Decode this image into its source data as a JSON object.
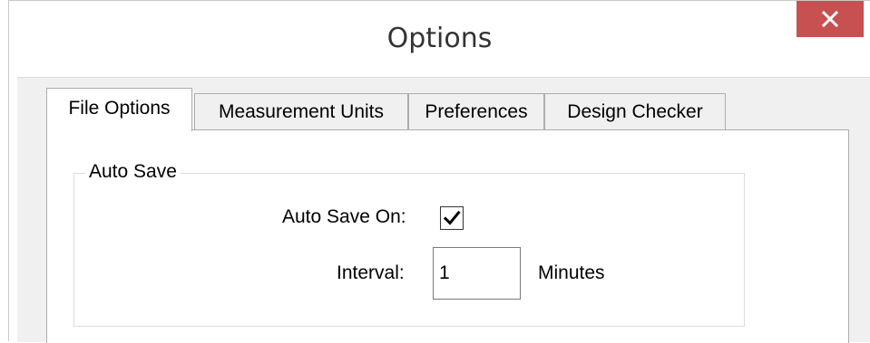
{
  "window": {
    "title": "Options",
    "close_icon": "close-x-icon"
  },
  "tabs": [
    {
      "label": "File Options",
      "active": true
    },
    {
      "label": "Measurement Units",
      "active": false
    },
    {
      "label": "Preferences",
      "active": false
    },
    {
      "label": "Design Checker",
      "active": false
    }
  ],
  "auto_save": {
    "group_label": "Auto Save",
    "toggle_label": "Auto Save On:",
    "toggle_checked": true,
    "interval_label": "Interval:",
    "interval_value": "1",
    "interval_unit": "Minutes"
  },
  "colors": {
    "close_button": "#c75050",
    "dialog_background": "#f0f0f0",
    "panel_background": "#ffffff"
  }
}
